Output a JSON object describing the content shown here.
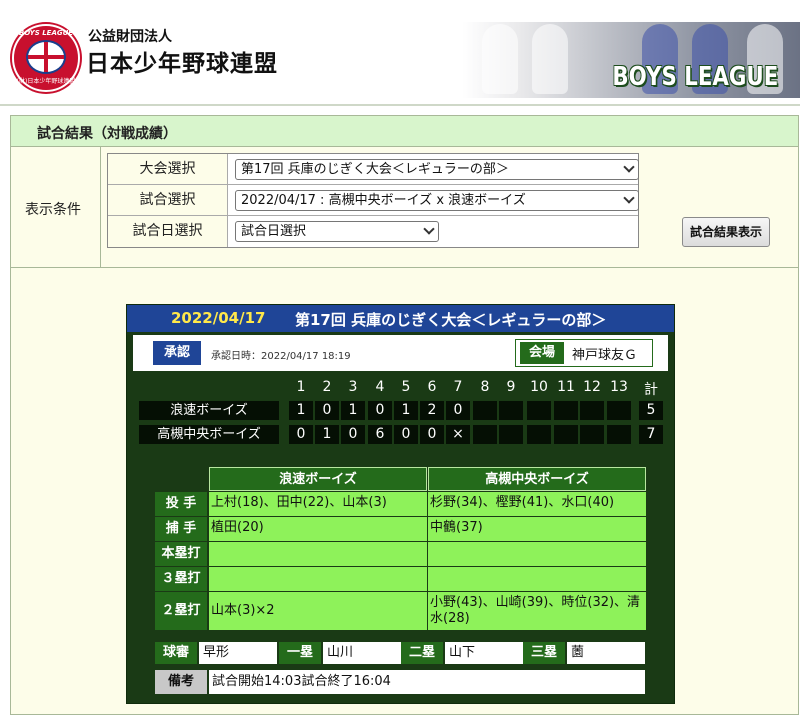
{
  "header": {
    "logo_top": "BOYS LEAGUE",
    "logo_bottom": "(財)日本少年野球連盟",
    "org_type": "公益財団法人",
    "org_name": "日本少年野球連盟",
    "banner_text": "BOYS LEAGUE"
  },
  "panel": {
    "title": "試合結果（対戦成績）",
    "condition_label": "表示条件",
    "rows": [
      {
        "label": "大会選択",
        "value": "第17回 兵庫のじぎく大会＜レギュラーの部＞"
      },
      {
        "label": "試合選択",
        "value": "2022/04/17 : 高槻中央ボーイズ x 浪速ボーイズ"
      },
      {
        "label": "試合日選択",
        "value": "試合日選択"
      }
    ],
    "show_button": "試合結果表示"
  },
  "result": {
    "date": "2022/04/17",
    "title": "第17回 兵庫のじぎく大会＜レギュラーの部＞",
    "approval_badge": "承認",
    "approval_time": "承認日時：2022/04/17 18:19",
    "venue_label": "会場",
    "venue": "神戸球友Ｇ",
    "innings": [
      "1",
      "2",
      "3",
      "4",
      "5",
      "6",
      "7",
      "8",
      "9",
      "10",
      "11",
      "12",
      "13"
    ],
    "total_label": "計",
    "teams": [
      {
        "name": "浪速ボーイズ",
        "scores": [
          "1",
          "0",
          "1",
          "0",
          "1",
          "2",
          "0",
          "",
          "",
          "",
          "",
          "",
          ""
        ],
        "total": "5"
      },
      {
        "name": "高槻中央ボーイズ",
        "scores": [
          "0",
          "1",
          "0",
          "6",
          "0",
          "0",
          "×",
          "",
          "",
          "",
          "",
          "",
          ""
        ],
        "total": "7"
      }
    ],
    "stats_headers": [
      "浪速ボーイズ",
      "高槻中央ボーイズ"
    ],
    "stats": [
      {
        "label": "投 手",
        "team1": "上村(18)、田中(22)、山本(3)",
        "team2": "杉野(34)、樫野(41)、水口(40)"
      },
      {
        "label": "捕 手",
        "team1": "植田(20)",
        "team2": "中鶴(37)"
      },
      {
        "label": "本塁打",
        "team1": "",
        "team2": ""
      },
      {
        "label": "３塁打",
        "team1": "",
        "team2": ""
      },
      {
        "label": "２塁打",
        "team1": "山本(3)×2",
        "team2": "小野(43)、山崎(39)、時位(32)、清水(28)"
      }
    ],
    "umpires": [
      {
        "label": "球審",
        "name": "早形"
      },
      {
        "label": "一塁",
        "name": "山川"
      },
      {
        "label": "二塁",
        "name": "山下"
      },
      {
        "label": "三塁",
        "name": "薗"
      }
    ],
    "note_label": "備考",
    "note": "試合開始14:03試合終了16:04"
  }
}
